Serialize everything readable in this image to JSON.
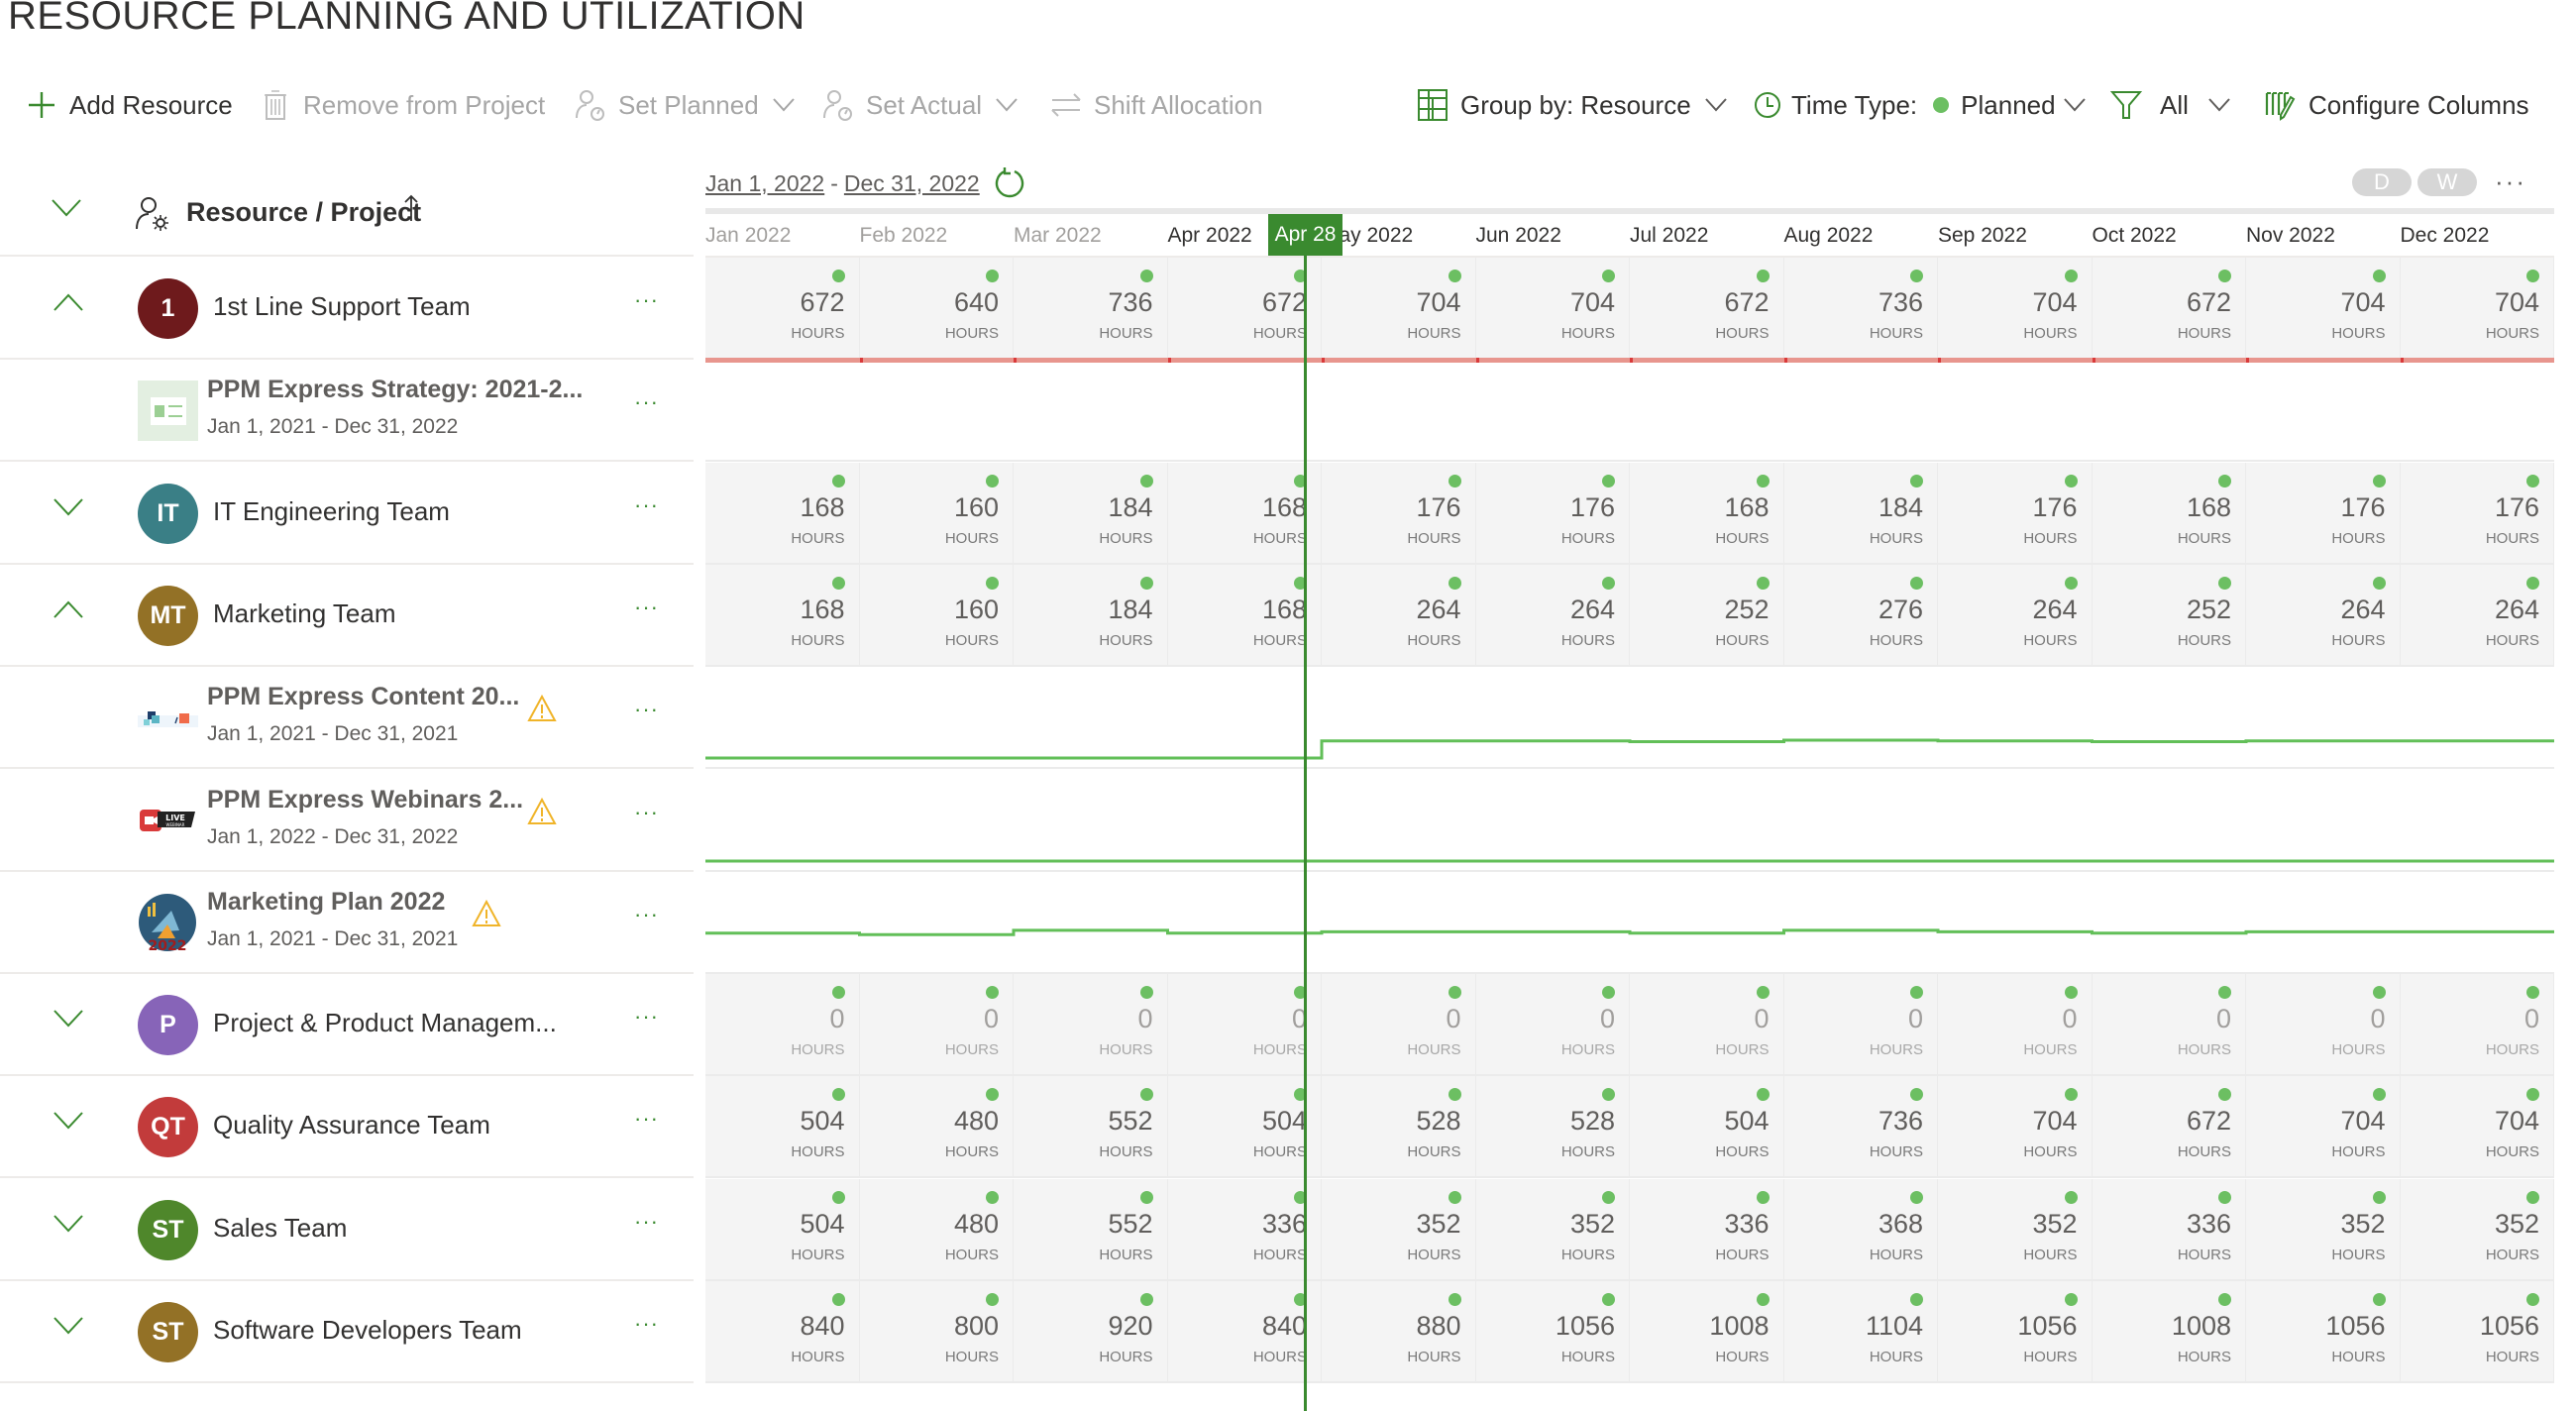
{
  "page": {
    "title": "RESOURCE PLANNING AND UTILIZATION"
  },
  "toolbar": {
    "add_resource": "Add Resource",
    "remove_from_project": "Remove from Project",
    "set_planned": "Set Planned",
    "set_actual": "Set Actual",
    "shift_allocation": "Shift Allocation",
    "group_by": "Group by: Resource",
    "time_type_label": "Time Type:",
    "time_type_value": "Planned",
    "filter_value": "All",
    "configure_columns": "Configure Columns",
    "accent_color": "#3a8a2f"
  },
  "header": {
    "column_label": "Resource / Project",
    "sort": "ascending",
    "range_start": "Jan 1, 2022",
    "range_sep": "-",
    "range_end": "Dec 31, 2022",
    "scale_buttons": [
      "D",
      "W"
    ],
    "more": "···"
  },
  "timeline": {
    "months": [
      "Jan 2022",
      "Feb 2022",
      "Mar 2022",
      "Apr 2022",
      "May 2022",
      "Jun 2022",
      "Jul 2022",
      "Aug 2022",
      "Sep 2022",
      "Oct 2022",
      "Nov 2022",
      "Dec 2022"
    ],
    "today_label": "Apr 28",
    "today_month_fraction": 3.9,
    "unit_label": "HOURS"
  },
  "rows": [
    {
      "type": "resource",
      "expanded": true,
      "initials": "1",
      "color": "#6e1a1c",
      "name": "1st Line Support Team",
      "hours": [
        672,
        640,
        736,
        672,
        704,
        704,
        672,
        736,
        704,
        672,
        704,
        704
      ],
      "overallocated": true
    },
    {
      "type": "project",
      "name": "PPM Express Strategy: 2021-2...",
      "dates": "Jan 1, 2021 - Dec 31, 2022",
      "thumb": "strategy",
      "warning": false,
      "line": []
    },
    {
      "type": "resource",
      "expanded": false,
      "initials": "IT",
      "color": "#3a7f86",
      "name": "IT Engineering Team",
      "hours": [
        168,
        160,
        184,
        168,
        176,
        176,
        168,
        184,
        176,
        168,
        176,
        176
      ]
    },
    {
      "type": "resource",
      "expanded": true,
      "initials": "MT",
      "color": "#937126",
      "name": "Marketing Team",
      "hours": [
        168,
        160,
        184,
        168,
        264,
        264,
        252,
        276,
        264,
        252,
        264,
        264
      ]
    },
    {
      "type": "project",
      "name": "PPM Express Content 20...",
      "dates": "Jan 1, 2021 - Dec 31, 2021",
      "thumb": "content",
      "warning": true,
      "line": [
        0,
        0,
        0,
        0,
        96,
        96,
        92,
        100,
        96,
        92,
        96,
        96
      ]
    },
    {
      "type": "project",
      "name": "PPM Express Webinars 2...",
      "dates": "Jan 1, 2022 - Dec 31, 2022",
      "thumb": "webinar",
      "warning": true,
      "line": [
        0,
        0,
        0,
        0,
        0,
        0,
        0,
        0,
        0,
        0,
        0,
        0
      ]
    },
    {
      "type": "project",
      "name": "Marketing Plan 2022",
      "dates": "Jan 1, 2021 - Dec 31, 2021",
      "thumb": "plan",
      "warning": true,
      "line": [
        168,
        160,
        184,
        168,
        176,
        176,
        168,
        184,
        176,
        168,
        176,
        176
      ]
    },
    {
      "type": "resource",
      "expanded": false,
      "initials": "P",
      "color": "#8764b8",
      "name": "Project & Product Managem...",
      "hours": [
        0,
        0,
        0,
        0,
        0,
        0,
        0,
        0,
        0,
        0,
        0,
        0
      ]
    },
    {
      "type": "resource",
      "expanded": false,
      "initials": "QT",
      "color": "#c23b3b",
      "name": "Quality Assurance Team",
      "hours": [
        504,
        480,
        552,
        504,
        528,
        528,
        504,
        736,
        704,
        672,
        704,
        704
      ]
    },
    {
      "type": "resource",
      "expanded": false,
      "initials": "ST",
      "color": "#4f872b",
      "name": "Sales Team",
      "hours": [
        504,
        480,
        552,
        336,
        352,
        352,
        336,
        368,
        352,
        336,
        352,
        352
      ]
    },
    {
      "type": "resource",
      "expanded": false,
      "initials": "ST",
      "color": "#937126",
      "name": "Software Developers Team",
      "hours": [
        840,
        800,
        920,
        840,
        880,
        1056,
        1008,
        1104,
        1056,
        1008,
        1056,
        1056
      ]
    }
  ]
}
